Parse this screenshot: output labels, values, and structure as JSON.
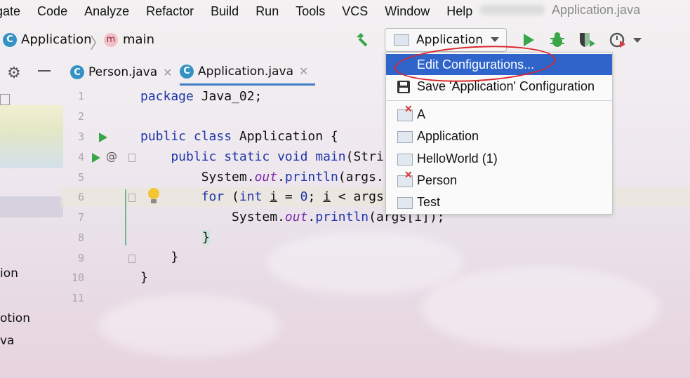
{
  "menu": {
    "items": [
      "gate",
      "Code",
      "Analyze",
      "Refactor",
      "Build",
      "Run",
      "Tools",
      "VCS",
      "Window",
      "Help"
    ],
    "window_title": "Application.java"
  },
  "breadcrumb": {
    "class_icon": "C",
    "class_name": "Application",
    "method_icon": "m",
    "method_name": "main"
  },
  "run_config": {
    "selected": "Application"
  },
  "tabs": [
    {
      "label": "Person.java",
      "close": "✕"
    },
    {
      "label": "Application.java",
      "close": "✕"
    }
  ],
  "left_panel": {
    "labels": [
      "ion",
      "otion",
      "va"
    ]
  },
  "editor": {
    "line_numbers": [
      "1",
      "2",
      "3",
      "4",
      "5",
      "6",
      "7",
      "8",
      "9",
      "10",
      "11"
    ],
    "code": {
      "l1a": "package ",
      "l1b": "Java_02;",
      "l3a": "public class ",
      "l3b": "Application {",
      "l4a": "    public static void ",
      "l4b": "main",
      "l4c": "(Stri",
      "l5a": "        System.",
      "l5b": "out",
      "l5c": ".",
      "l5d": "println",
      "l5e": "(args.",
      "l6a": "        for ",
      "l6b": "(",
      "l6c": "int ",
      "l6d": "i",
      "l6e": " = ",
      "l6f": "0",
      "l6g": "; ",
      "l6h": "i",
      "l6i": " < args",
      "l7a": "            System.",
      "l7b": "out",
      "l7c": ".",
      "l7d": "println",
      "l7e": "(args[i]);",
      "l8": "}",
      "l9": "    }",
      "l10": "}"
    }
  },
  "run_dropdown": {
    "edit": "Edit Configurations...",
    "save": "Save 'Application' Configuration",
    "configs": [
      {
        "label": "A",
        "error": true
      },
      {
        "label": "Application",
        "error": false
      },
      {
        "label": "HelloWorld (1)",
        "error": false
      },
      {
        "label": "Person",
        "error": true
      },
      {
        "label": "Test",
        "error": false
      }
    ]
  },
  "colors": {
    "accent": "#2f65ca",
    "keyword": "#1d35a8",
    "annotation": "#d9262b",
    "run_green": "#3aa64a"
  }
}
